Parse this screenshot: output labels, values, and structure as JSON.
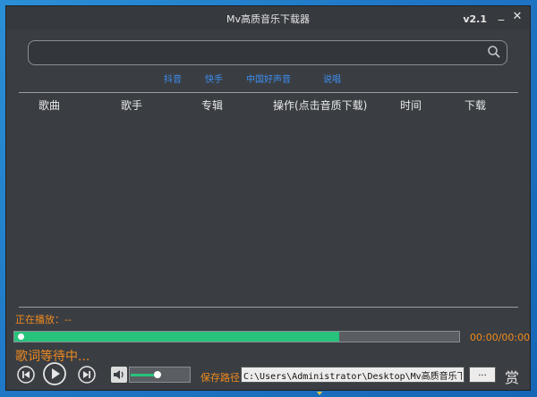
{
  "window": {
    "title": "Mv高质音乐下载器",
    "version": "v2.1",
    "min_label": "_",
    "close_label": "✕"
  },
  "search": {
    "value": "",
    "placeholder": ""
  },
  "quick_links": [
    "抖音",
    "快手",
    "中国好声音",
    "说唱"
  ],
  "table": {
    "columns": [
      "歌曲",
      "歌手",
      "专辑",
      "操作(点击音质下载)",
      "时间",
      "下载"
    ],
    "rows": []
  },
  "player": {
    "now_playing": "正在播放：--",
    "time": "00:00/00:00",
    "lyrics": "歌词等待中...",
    "progress": 0.73,
    "volume": 0.45
  },
  "save": {
    "label": "保存路径",
    "path": "C:\\Users\\Administrator\\Desktop\\Mv高质音乐下载器",
    "browse_label": "...",
    "reward_label": "赏"
  },
  "icons": {
    "search": "search-icon",
    "prev": "previous-icon",
    "play": "play-icon",
    "next": "next-icon",
    "volume": "speaker-icon"
  },
  "colors": {
    "accent_orange": "#f08a1e",
    "progress_green": "#27c27c",
    "link_blue": "#3d8ef0",
    "window_bg": "#3a3e43"
  }
}
